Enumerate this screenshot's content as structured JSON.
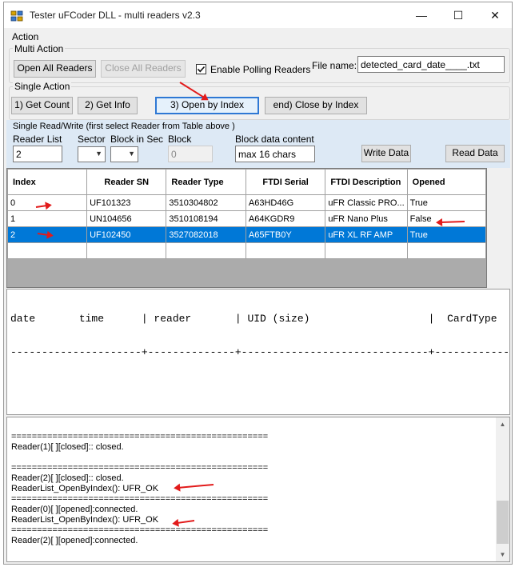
{
  "window": {
    "title": "Tester uFCoder DLL - multi readers v2.3",
    "min_glyph": "—",
    "max_glyph": "☐",
    "close_glyph": "✕"
  },
  "action": {
    "title": "Action",
    "multi_title": "Multi Action",
    "open_all": "Open All Readers",
    "close_all": "Close All Readers",
    "polling_label": "Enable Polling Readers",
    "polling_checked": true,
    "file_name_label": "File name:",
    "file_name_value": "detected_card_date____.txt",
    "single_title": "Single Action",
    "get_count": "1) Get Count",
    "get_info": "2) Get Info",
    "open_by_index": "3) Open by Index",
    "close_by_index": "end) Close by Index"
  },
  "rw": {
    "header": "Single Read/Write  (first select Reader from Table above )",
    "reader_list_label": "Reader List",
    "reader_list_value": "2",
    "sector_label": "Sector",
    "block_in_sec_label": "Block in Sec",
    "block_label": "Block",
    "block_value": "0",
    "block_data_label": "Block data content",
    "block_data_value": "max 16 chars",
    "write_btn": "Write Data",
    "read_btn": "Read Data"
  },
  "grid": {
    "headers": [
      "Index",
      "Reader SN",
      "Reader Type",
      "FTDI Serial",
      "FTDI Description",
      "Opened"
    ],
    "rows": [
      [
        "0",
        "UF101323",
        "3510304802",
        "A63HD46G",
        "uFR Classic PRO...",
        "True"
      ],
      [
        "1",
        "UN104656",
        "3510108194",
        "A64KGDR9",
        "uFR Nano Plus",
        "False"
      ],
      [
        "2",
        "UF102450",
        "3527082018",
        "A65FTB0Y",
        "uFR XL RF AMP",
        "True"
      ]
    ],
    "selected_row": 2
  },
  "card_log": {
    "header": "date       time      | reader       | UID (size)                   |  CardType",
    "separator": "---------------------+--------------+------------------------------+---------------"
  },
  "log": {
    "lines": [
      "==================================================",
      "Reader(1)[ ][closed]:: closed.",
      "",
      "==================================================",
      "Reader(2)[ ][closed]:: closed.",
      "ReaderList_OpenByIndex(): UFR_OK",
      "==================================================",
      "Reader(0)[ ][opened]:connected.",
      "ReaderList_OpenByIndex(): UFR_OK",
      "==================================================",
      "Reader(2)[ ][opened]:connected."
    ]
  },
  "colors": {
    "selection": "#0078d7",
    "annotation_arrow": "#e21b1b",
    "focus_border": "#2e78d4"
  }
}
